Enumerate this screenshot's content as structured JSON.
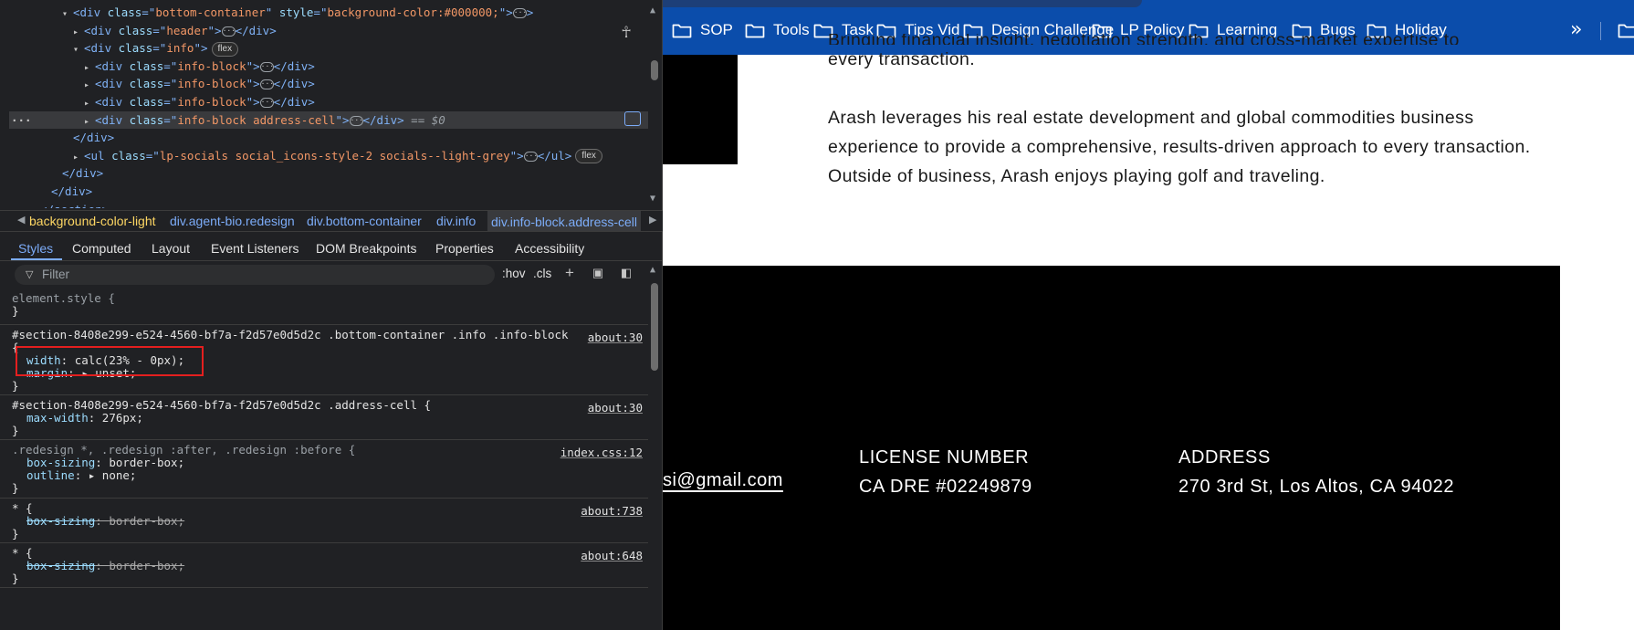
{
  "devtools": {
    "tree": [
      {
        "indent": 0,
        "arrow": "▾",
        "tag": "div",
        "class": "bottom-container",
        "style": "background-color:#000000;",
        "tail": ">"
      },
      {
        "indent": 1,
        "arrow": "▸",
        "tag": "div",
        "class": "header",
        "tail": "</div>"
      },
      {
        "indent": 1,
        "arrow": "▾",
        "tag": "div",
        "class": "info",
        "badge": "flex"
      },
      {
        "indent": 2,
        "arrow": "▸",
        "tag": "div",
        "class": "info-block",
        "tail": "</div>"
      },
      {
        "indent": 2,
        "arrow": "▸",
        "tag": "div",
        "class": "info-block",
        "tail": "</div>"
      },
      {
        "indent": 2,
        "arrow": "▸",
        "tag": "div",
        "class": "info-block",
        "tail": "</div>"
      },
      {
        "indent": 2,
        "arrow": "▸",
        "tag": "div",
        "class": "info-block address-cell",
        "tail": "</div>",
        "selected_marker": "== $0"
      },
      {
        "indent": 1,
        "close": "</div>"
      },
      {
        "indent": 1,
        "arrow": "▸",
        "tag": "ul",
        "class": "lp-socials social_icons-style-2 socials--light-grey",
        "tail": "</ul>",
        "badge": "flex"
      },
      {
        "indent": 0,
        "close": "</div>"
      },
      {
        "indent": -1,
        "close": "</div>"
      },
      {
        "indent": -2,
        "close": "</section>"
      }
    ],
    "breadcrumbs": [
      "background-color-light",
      "div.agent-bio.redesign",
      "div.bottom-container",
      "div.info",
      "div.info-block.address-cell"
    ],
    "subtabs": [
      "Styles",
      "Computed",
      "Layout",
      "Event Listeners",
      "DOM Breakpoints",
      "Properties",
      "Accessibility"
    ],
    "filter_placeholder": "Filter",
    "hov": ":hov",
    "cls": ".cls",
    "rules": [
      {
        "selector": "element.style {",
        "source": "",
        "lines": [],
        "close": "}"
      },
      {
        "selector": "#section-8408e299-e524-4560-bf7a-f2d57e0d5d2c .bottom-container .info .info-block",
        "source": "about:30",
        "open": "{",
        "lines": [
          {
            "name": "width",
            "value": "calc(23% - 0px);"
          },
          {
            "name": "margin",
            "value": "▸ unset;"
          }
        ],
        "close": "}"
      },
      {
        "selector": "#section-8408e299-e524-4560-bf7a-f2d57e0d5d2c .address-cell {",
        "source": "about:30",
        "lines": [
          {
            "name": "max-width",
            "value": "276px;"
          }
        ],
        "close": "}"
      },
      {
        "selector": ".redesign *, .redesign :after, .redesign :before {",
        "source": "index.css:12",
        "lines": [
          {
            "name": "box-sizing",
            "value": "border-box;"
          },
          {
            "name": "outline",
            "value": "▸ none;"
          }
        ],
        "close": "}"
      },
      {
        "selector": "* {",
        "source": "about:738",
        "lines": [
          {
            "name": "box-sizing",
            "value": "border-box;",
            "strike": true
          }
        ],
        "close": "}"
      },
      {
        "selector": "* {",
        "source": "about:648",
        "lines": [
          {
            "name": "box-sizing",
            "value": "border-box;",
            "strike": true
          }
        ],
        "close": "}"
      }
    ]
  },
  "bookmarks": [
    "SOP",
    "Tools",
    "Task",
    "Tips Vid",
    "Design Challenge",
    "LP Policy",
    "Learning",
    "Bugs",
    "Holiday"
  ],
  "bookmarks_overflow": "»",
  "page": {
    "bio_para1_clipped": "Bringing financial insight, negotiation strength, and cross-market expertise to",
    "bio_para1_line2": "every transaction.",
    "bio_para2": "Arash leverages his real estate development and global commodities business experience to provide a comprehensive, results-driven approach to every transaction. Outside of business, Arash enjoys playing golf and traveling.",
    "email_partial": "si@gmail.com",
    "license_label": "LICENSE NUMBER",
    "license_value": "CA DRE #02249879",
    "address_label": "ADDRESS",
    "address_value": "270 3rd St, Los Altos, CA 94022"
  }
}
